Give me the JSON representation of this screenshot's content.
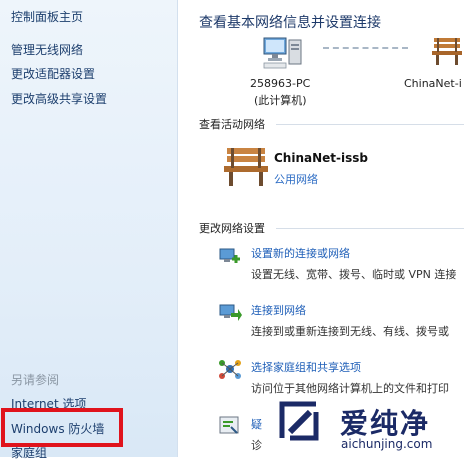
{
  "left_nav": {
    "home": "控制面板主页",
    "links": [
      "管理无线网络",
      "更改适配器设置",
      "更改高级共享设置"
    ],
    "see_also_label": "另请参阅",
    "see_also_links": [
      "Internet 选项",
      "Windows 防火墙",
      "家庭组"
    ]
  },
  "main": {
    "title": "查看基本网络信息并设置连接",
    "map": {
      "computer_name": "258963-PC",
      "computer_sub": "(此计算机)",
      "network_name": "ChinaNet-i"
    },
    "active_networks": {
      "label": "查看活动网络",
      "network_name": "ChinaNet-issb",
      "network_type": "公用网络"
    },
    "change_settings": {
      "label": "更改网络设置",
      "tasks": [
        {
          "link": "设置新的连接或网络",
          "desc": "设置无线、宽带、拨号、临时或 VPN 连接"
        },
        {
          "link": "连接到网络",
          "desc": "连接到或重新连接到无线、有线、拨号或"
        },
        {
          "link": "选择家庭组和共享选项",
          "desc": "访问位于其他网络计算机上的文件和打印"
        },
        {
          "link": "疑",
          "desc": "诊"
        }
      ]
    }
  },
  "watermark": {
    "text": "爱纯净",
    "url": "aichunjing.com"
  },
  "colors": {
    "highlight": "#e0131c",
    "link": "#1f5fb8",
    "nav_bg": "#e3eef9"
  }
}
